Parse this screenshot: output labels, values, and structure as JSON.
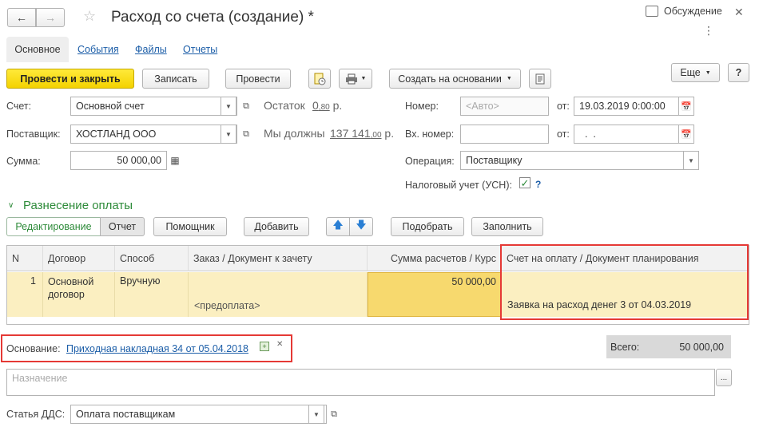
{
  "window": {
    "title": "Расход со счета (создание) *",
    "discussion_label": "Обсуждение",
    "more_label": "Еще",
    "help_label": "?"
  },
  "tabs": [
    "Основное",
    "События",
    "Файлы",
    "Отчеты"
  ],
  "toolbar": {
    "post_close": "Провести и закрыть",
    "save": "Записать",
    "post": "Провести",
    "create_based": "Создать на основании"
  },
  "form": {
    "account_label": "Счет:",
    "account_value": "Основной счет",
    "balance_label": "Остаток",
    "balance_int": "0",
    "balance_frac": ",80",
    "balance_unit": "р.",
    "supplier_label": "Поставщик:",
    "supplier_value": "ХОСТЛАНД ООО",
    "we_owe_label": "Мы должны",
    "we_owe_int": "137 141",
    "we_owe_frac": ",00",
    "we_owe_unit": "р.",
    "sum_label": "Сумма:",
    "sum_value": "50 000,00",
    "number_label": "Номер:",
    "number_placeholder": "<Авто>",
    "from_label": "от:",
    "date_value": "19.03.2019  0:00:00",
    "in_number_label": "Вх. номер:",
    "in_number_value": "",
    "in_from_label": "от:",
    "in_date_value": "  .  .",
    "operation_label": "Операция:",
    "operation_value": "Поставщику",
    "tax_label": "Налоговый учет (УСН):",
    "tax_checked": "✓",
    "tax_help": "?"
  },
  "allocation": {
    "section_title": "Разнесение оплаты",
    "edit_tab": "Редактирование",
    "report_tab": "Отчет",
    "assistant": "Помощник",
    "add": "Добавить",
    "pick": "Подобрать",
    "fill": "Заполнить"
  },
  "table": {
    "headers": [
      "N",
      "Договор",
      "Способ",
      "Заказ / Документ к зачету",
      "Сумма расчетов / Курс",
      "Счет на оплату / Документ планирования"
    ],
    "row": {
      "n": "1",
      "contract": "Основной договор",
      "method": "Вручную",
      "order_sub": "<предоплата>",
      "amount": "50 000,00",
      "invoice": "Заявка на расход денег 3 от 04.03.2019"
    }
  },
  "footer": {
    "basis_label": "Основание:",
    "basis_link": "Приходная накладная 34 от 05.04.2018",
    "total_label": "Всего:",
    "total_value": "50 000,00",
    "purpose_placeholder": "Назначение",
    "dds_label": "Статья ДДС:",
    "dds_value": "Оплата поставщикам"
  },
  "colors": {
    "accent_link": "#1c5ea8",
    "primary_button": "#f4d200",
    "section_green": "#2e8b3a",
    "highlight_row": "#fbefc1",
    "selected_cell": "#f7d96e",
    "annotation_red": "#e53935"
  }
}
